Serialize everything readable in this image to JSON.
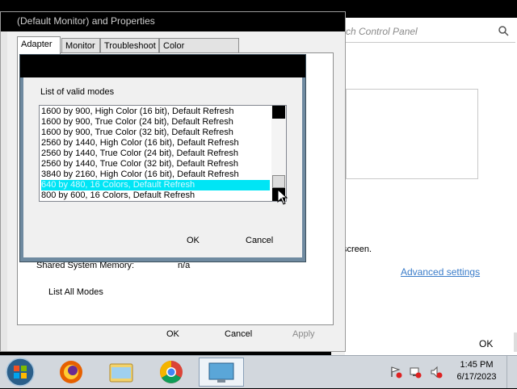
{
  "background_window": {
    "search_placeholder": "rch Control Panel",
    "screen_text": "screen.",
    "advanced_link": "Advanced settings",
    "ok_label": "OK"
  },
  "properties": {
    "title": "(Default Monitor) and  Properties",
    "tabs": [
      "Adapter",
      "Monitor",
      "Troubleshoot",
      "Color Management"
    ],
    "shared_memory_label": "Shared System Memory:",
    "shared_memory_value": "n/a",
    "list_all_modes_label": "List All Modes",
    "ok_label": "OK",
    "cancel_label": "Cancel",
    "apply_label": "Apply"
  },
  "modal": {
    "label": "List of valid modes",
    "modes": [
      "1600 by 900, High Color (16 bit), Default Refresh",
      "1600 by 900, True Color (24 bit), Default Refresh",
      "1600 by 900, True Color (32 bit), Default Refresh",
      "2560 by 1440, High Color (16 bit), Default Refresh",
      "2560 by 1440, True Color (24 bit), Default Refresh",
      "2560 by 1440, True Color (32 bit), Default Refresh",
      "3840 by 2160, High Color (16 bit), Default Refresh",
      "640 by 480, 16 Colors, Default Refresh",
      "800 by 600, 16 Colors, Default Refresh"
    ],
    "selected_index": 7,
    "ok_label": "OK",
    "cancel_label": "Cancel"
  },
  "taskbar": {
    "time": "1:45 PM",
    "date": "6/17/2023",
    "pinned": [
      "firefox-icon",
      "file-explorer-icon",
      "chrome-icon",
      "display-settings-icon"
    ],
    "tray": [
      "action-center-icon",
      "network-icon",
      "volume-muted-icon"
    ]
  },
  "colors": {
    "selection": "#00e5f5",
    "link": "#3a7cc9",
    "taskbar": "#d2d7dd"
  }
}
